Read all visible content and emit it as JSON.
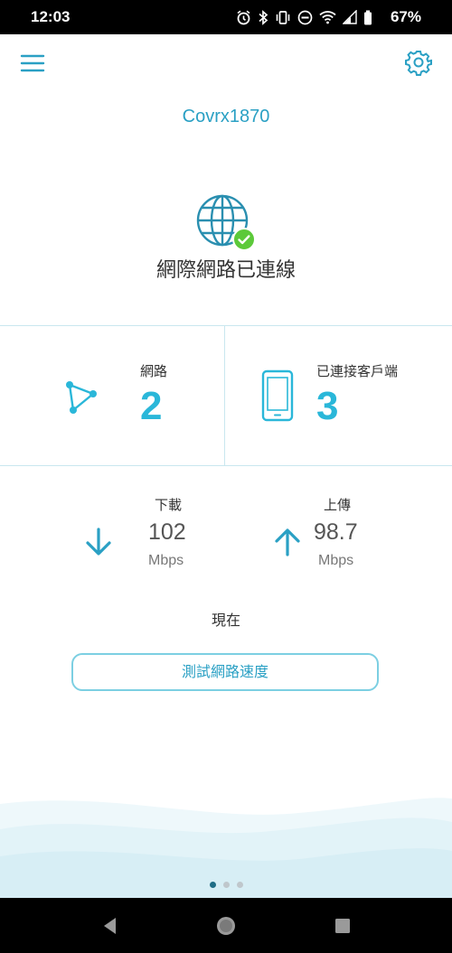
{
  "status_bar": {
    "time": "12:03",
    "battery_percent": "67%",
    "icons": [
      "alarm-icon",
      "bluetooth-icon",
      "vibrate-icon",
      "do-not-disturb-icon",
      "wifi-icon",
      "signal-icon",
      "battery-icon"
    ]
  },
  "header": {
    "menu_icon": "hamburger-menu-icon",
    "settings_icon": "gear-icon",
    "device_name": "Covrx1870"
  },
  "connection": {
    "status_text": "網際網路已連線",
    "icon": "globe-icon",
    "badge_icon": "check-badge-icon"
  },
  "stats": {
    "network": {
      "label": "網路",
      "value": "2",
      "icon": "mesh-network-icon"
    },
    "clients": {
      "label": "已連接客戶端",
      "value": "3",
      "icon": "phone-icon"
    }
  },
  "speed": {
    "download": {
      "label": "下載",
      "value": "102",
      "unit": "Mbps",
      "icon": "arrow-down-icon"
    },
    "upload": {
      "label": "上傳",
      "value": "98.7",
      "unit": "Mbps",
      "icon": "arrow-up-icon"
    },
    "timeframe": "現在"
  },
  "actions": {
    "speed_test_label": "測試網路速度"
  },
  "pager": {
    "count": 3,
    "active_index": 0
  },
  "colors": {
    "accent": "#2ab7d9",
    "accent_dark": "#2aa0c4",
    "divider": "#c9e7ef",
    "success": "#5cc93a"
  }
}
